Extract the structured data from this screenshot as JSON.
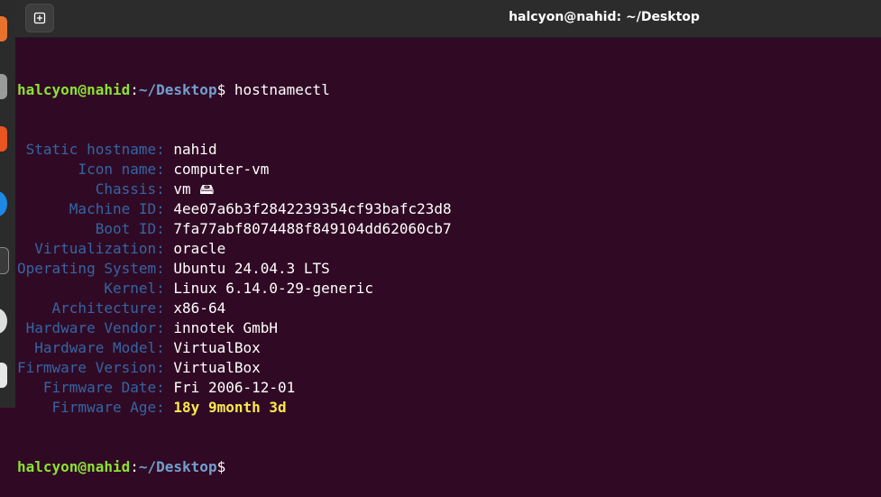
{
  "window": {
    "title": "halcyon@nahid: ~/Desktop"
  },
  "prompt": {
    "user_host": "halcyon@nahid",
    "sep": ":",
    "path": "~/Desktop",
    "symbol": "$"
  },
  "command": "hostnamectl",
  "rows": [
    {
      "label": "Static hostname:",
      "value": "nahid"
    },
    {
      "label": "Icon name:",
      "value": "computer-vm"
    },
    {
      "label": "Chassis:",
      "value": "vm 🖴"
    },
    {
      "label": "Machine ID:",
      "value": "4ee07a6b3f2842239354cf93bafc23d8"
    },
    {
      "label": "Boot ID:",
      "value": "7fa77abf8074488f849104dd62060cb7"
    },
    {
      "label": "Virtualization:",
      "value": "oracle"
    },
    {
      "label": "Operating System:",
      "value": "Ubuntu 24.04.3 LTS"
    },
    {
      "label": "Kernel:",
      "value": "Linux 6.14.0-29-generic"
    },
    {
      "label": "Architecture:",
      "value": "x86-64"
    },
    {
      "label": "Hardware Vendor:",
      "value": "innotek GmbH"
    },
    {
      "label": "Hardware Model:",
      "value": "VirtualBox"
    },
    {
      "label": "Firmware Version:",
      "value": "VirtualBox"
    },
    {
      "label": "Firmware Date:",
      "value": "Fri 2006-12-01"
    },
    {
      "label": "Firmware Age:",
      "value": "18y 9month 3d"
    }
  ],
  "colors": {
    "background": "#300a24",
    "user": "#8ae234",
    "path": "#729fcf",
    "label": "#3465a4",
    "warn": "#fce94f"
  },
  "icons": {
    "newtab": "new-tab-icon"
  }
}
